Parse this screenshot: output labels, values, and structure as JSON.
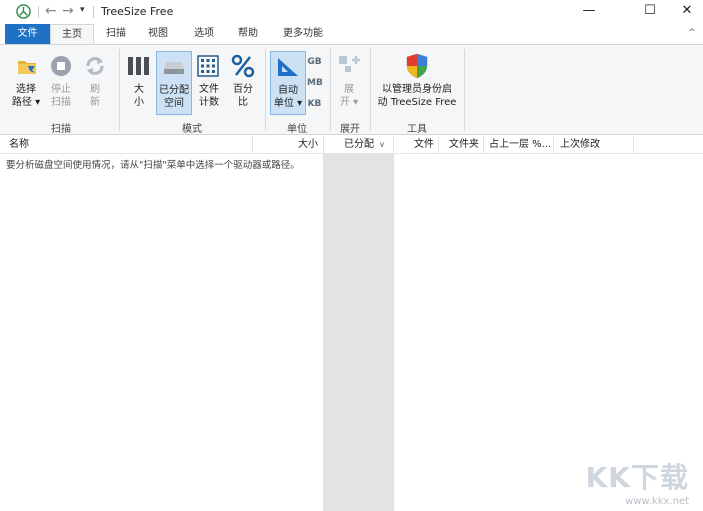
{
  "window": {
    "title": "TreeSize Free",
    "minimize_glyph": "—",
    "maximize_glyph": "☐",
    "close_glyph": "✕"
  },
  "quick_access": {
    "back_glyph": "←",
    "forward_glyph": "→",
    "dropdown_glyph": "▾"
  },
  "tabs": [
    {
      "label": "文件"
    },
    {
      "label": "主页"
    },
    {
      "label": "扫描"
    },
    {
      "label": "视图"
    },
    {
      "label": "选项"
    },
    {
      "label": "帮助"
    },
    {
      "label": "更多功能"
    }
  ],
  "ribbon": {
    "collapse_glyph": "^",
    "groups": {
      "scan": {
        "label": "扫描",
        "buttons": [
          {
            "line1": "选择",
            "line2": "路径 ▾",
            "icon": "folder-icon"
          },
          {
            "line1": "停止",
            "line2": "扫描",
            "icon": "stop-icon"
          },
          {
            "line1": "刷",
            "line2": "新",
            "icon": "refresh-icon"
          }
        ]
      },
      "mode": {
        "label": "模式",
        "buttons": [
          {
            "line1": "大",
            "line2": "小",
            "icon": "size-bars-icon"
          },
          {
            "line1": "已分配",
            "line2": "空间",
            "icon": "disk-icon"
          },
          {
            "line1": "文件",
            "line2": "计数",
            "icon": "grid-icon"
          },
          {
            "line1": "百分",
            "line2": "比",
            "icon": "percent-icon"
          }
        ]
      },
      "unit": {
        "label": "单位",
        "auto": {
          "line1": "自动",
          "line2": "单位 ▾",
          "icon": "ruler-icon"
        },
        "small": [
          "GB",
          "MB",
          "KB"
        ]
      },
      "expand": {
        "label": "展开",
        "button": {
          "line1": "展",
          "line2": "开 ▾",
          "icon": "expand-icon"
        }
      },
      "tools": {
        "label": "工具",
        "button": {
          "line1": "以管理员身份启",
          "line2": "动 TreeSize Free",
          "icon": "shield-icon"
        }
      }
    }
  },
  "columns": {
    "name": "名称",
    "size": "大小",
    "allocated": "已分配",
    "files": "文件",
    "folders": "文件夹",
    "percent_parent": "占上一层 %...",
    "last_modified": "上次修改"
  },
  "tree": {
    "message": "要分析磁盘空间使用情况，请从\"扫描\"菜单中选择一个驱动器或路径。"
  },
  "watermark": {
    "logo": "KK下载",
    "url": "www.kkx.net"
  },
  "colors": {
    "accent": "#1e72c6",
    "ribbon_bg": "#f5f6f7",
    "active_btn": "#cde1f5",
    "alloc_column": "#e3e3e3"
  }
}
